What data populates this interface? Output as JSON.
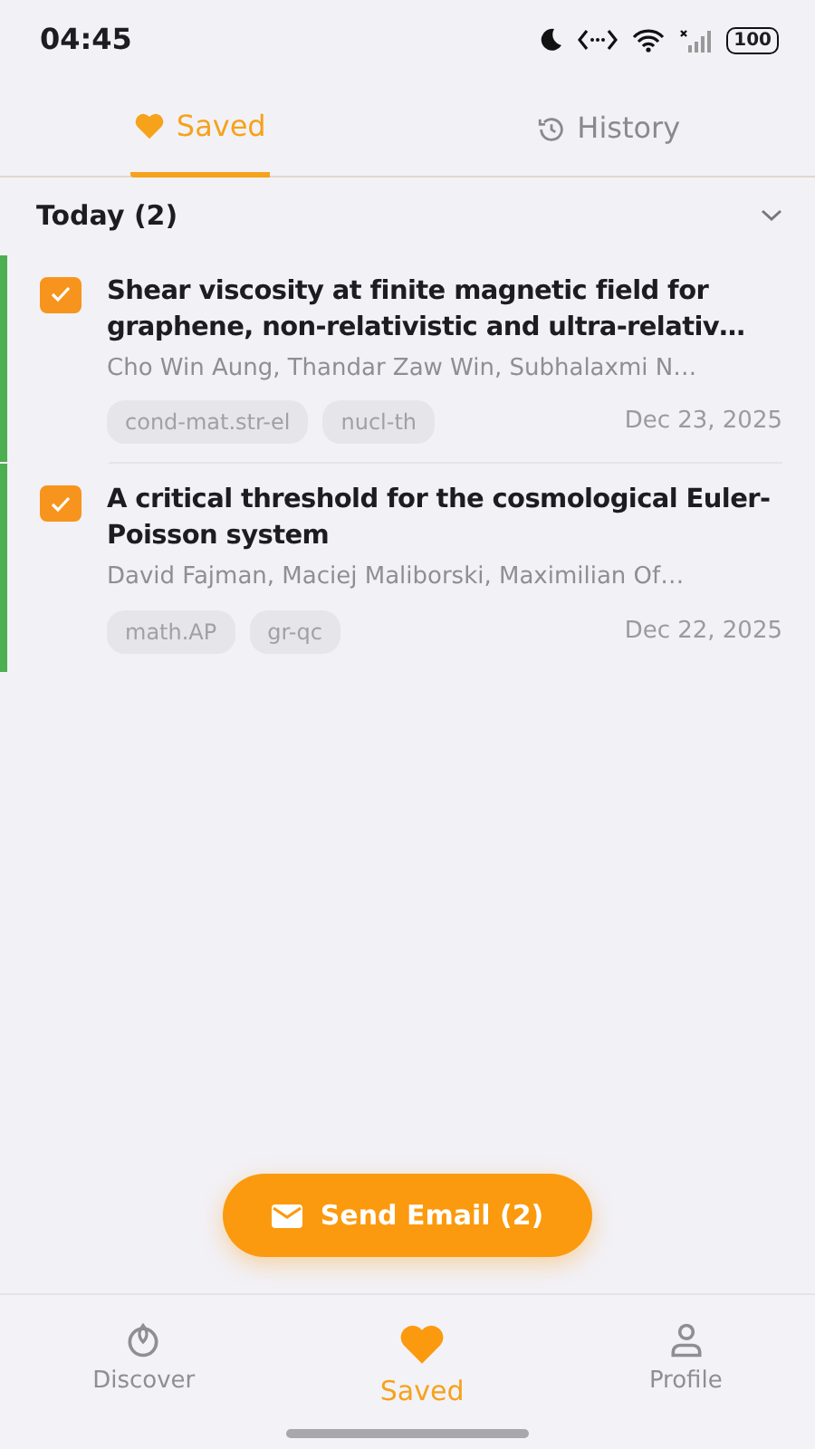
{
  "status_bar": {
    "time": "04:45",
    "battery": "100"
  },
  "tabs": [
    {
      "label": "Saved",
      "kind": "heart",
      "selected": true
    },
    {
      "label": "History",
      "kind": "history",
      "selected": false
    }
  ],
  "group": {
    "title": "Today (2)",
    "expanded": true
  },
  "papers": [
    {
      "title": "Shear viscosity at finite magnetic field for graphene, non-relativistic and ultra-relativ…",
      "authors": "Cho Win Aung, Thandar Zaw Win, Subhalaxmi N…",
      "tags": [
        "cond-mat.str-el",
        "nucl-th"
      ],
      "date": "Dec 23, 2025",
      "checked": true
    },
    {
      "title": "A critical threshold for the cosmological Euler-Poisson system",
      "authors": "David Fajman, Maciej Maliborski, Maximilian Of…",
      "tags": [
        "math.AP",
        "gr-qc"
      ],
      "date": "Dec 22, 2025",
      "checked": true
    }
  ],
  "send_button": "Send Email (2)",
  "bottom_nav": [
    {
      "label": "Discover",
      "kind": "discover",
      "selected": false
    },
    {
      "label": "Saved",
      "kind": "heart",
      "selected": true
    },
    {
      "label": "Profile",
      "kind": "profile",
      "selected": false
    }
  ]
}
